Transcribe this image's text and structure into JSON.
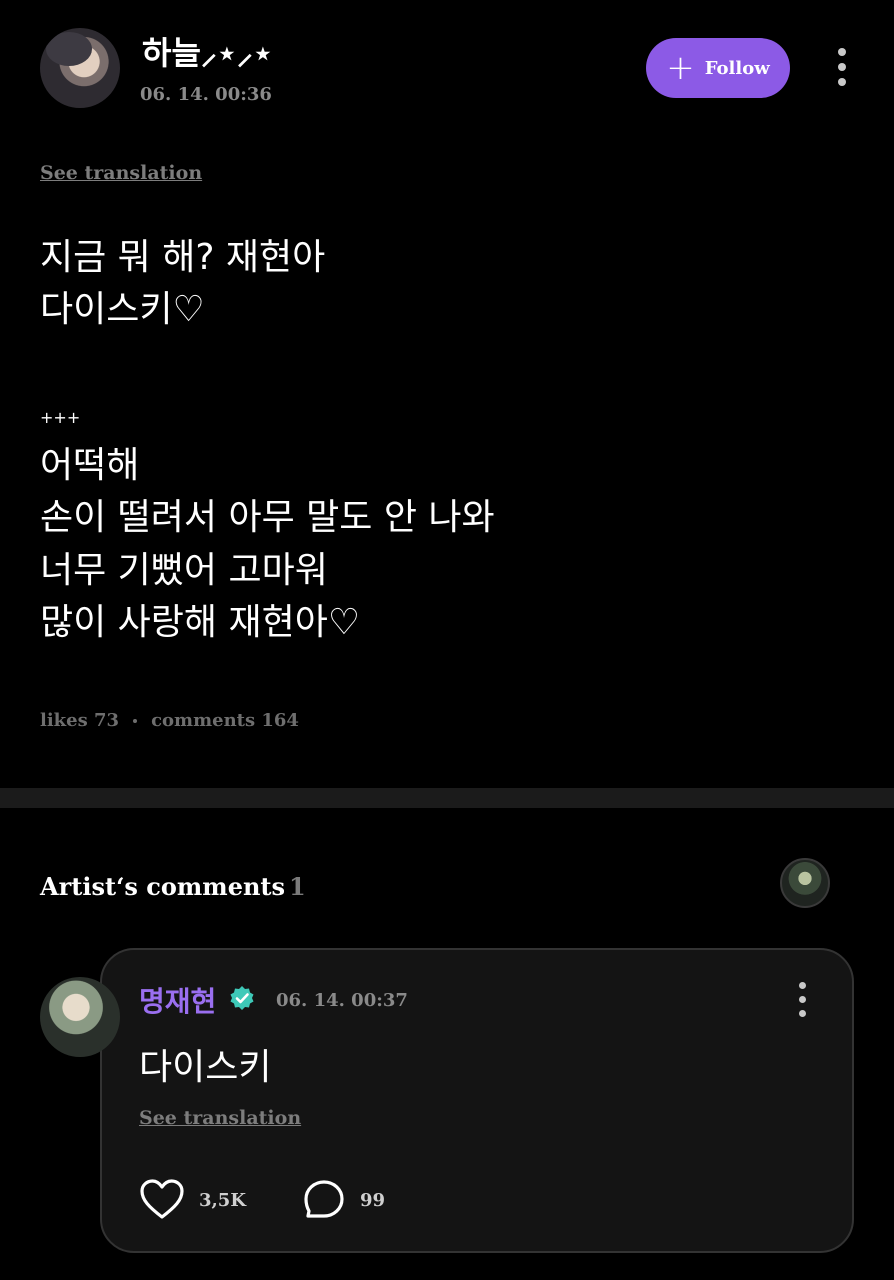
{
  "post": {
    "author": "하늘⸝⋆⸝⋆",
    "timestamp": "06. 14. 00:36",
    "follow_label": "Follow",
    "see_translation": "See translation",
    "lines_top": [
      "지금 뭐 해? 재현아",
      "다이스키♡"
    ],
    "separator": "+++",
    "lines_bottom": [
      "어떡해",
      "손이 떨려서 아무 말도 안 나와",
      "너무 기뻤어 고마워",
      "많이 사랑해 재현아♡"
    ],
    "likes_text": "likes 73",
    "comments_text": "comments 164"
  },
  "artist_comments": {
    "title": "Artist‘s comments",
    "count": "1"
  },
  "comment": {
    "author": "명재현",
    "timestamp": "06. 14. 00:37",
    "text": "다이스키",
    "see_translation": "See translation",
    "likes": "3,5K",
    "replies": "99"
  },
  "colors": {
    "accent": "#8c5ae6",
    "artist_name": "#9a6ff0",
    "verified": "#3ec9b8"
  }
}
